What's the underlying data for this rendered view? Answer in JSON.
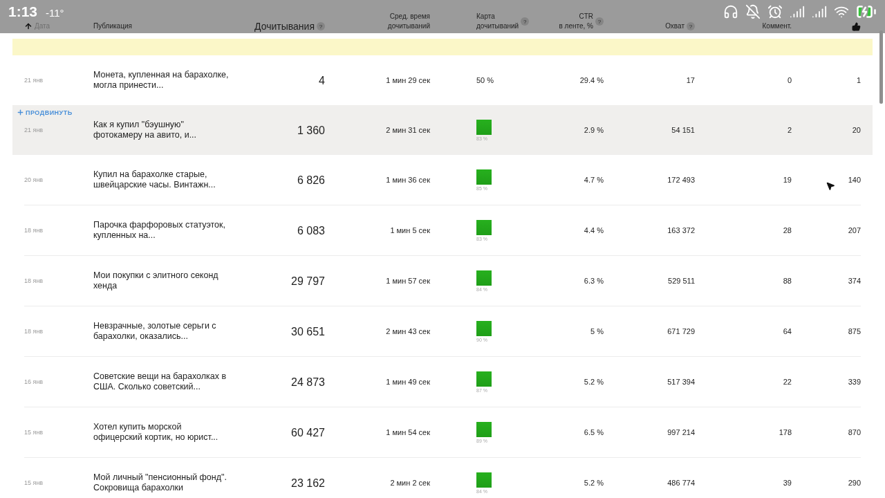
{
  "status_bar": {
    "time": "1:13",
    "temperature": "-11°"
  },
  "table": {
    "columns": [
      {
        "kind": "date",
        "lines": [
          "Дата"
        ],
        "sorted": true
      },
      {
        "kind": "publication",
        "lines": [
          "Публикация"
        ]
      },
      {
        "kind": "reads",
        "lines": [
          "Дочитывания"
        ],
        "hint": "?"
      },
      {
        "kind": "time",
        "lines": [
          "Сред. время",
          "дочитываний"
        ]
      },
      {
        "kind": "map",
        "lines": [
          "Карта",
          "дочитываний"
        ],
        "hint": "?"
      },
      {
        "kind": "ctr",
        "lines": [
          "CTR",
          "в ленте, %"
        ],
        "hint": "?"
      },
      {
        "kind": "reach",
        "lines": [
          "Охват"
        ],
        "hint": "?"
      },
      {
        "kind": "comments",
        "lines": [
          "Коммент."
        ]
      },
      {
        "kind": "likes"
      }
    ],
    "rows": [
      {
        "selected": false,
        "date": "21 янв",
        "title": "Монета, купленная на барахолке, могла принести...",
        "reads": "4",
        "time": "1 мин 29 сек",
        "map": {
          "kind": "text",
          "label": "50 %"
        },
        "ctr": "29.4 %",
        "reach": "17",
        "comments": "0",
        "likes": "1"
      },
      {
        "selected": true,
        "promote": "ПРОДВИНУТЬ",
        "date": "21 янв",
        "title": "Как я купил \"бэушную\" фотокамеру на авито, и...",
        "reads": "1 360",
        "time": "2 мин 31 сек",
        "map": {
          "kind": "square",
          "label": "83 %"
        },
        "ctr": "2.9 %",
        "reach": "54 151",
        "comments": "2",
        "likes": "20"
      },
      {
        "selected": false,
        "date": "20 янв",
        "title": "Купил на барахолке старые, швейцарские часы. Винтажн...",
        "reads": "6 826",
        "time": "1 мин 36 сек",
        "map": {
          "kind": "square",
          "label": "85 %"
        },
        "ctr": "4.7 %",
        "reach": "172 493",
        "comments": "19",
        "likes": "140"
      },
      {
        "selected": false,
        "date": "18 янв",
        "title": "Парочка фарфоровых статуэток, купленных на...",
        "reads": "6 083",
        "time": "1 мин 5 сек",
        "map": {
          "kind": "square",
          "label": "83 %"
        },
        "ctr": "4.4 %",
        "reach": "163 372",
        "comments": "28",
        "likes": "207"
      },
      {
        "selected": false,
        "date": "18 янв",
        "title": "Мои покупки с элитного секонд хенда",
        "reads": "29 797",
        "time": "1 мин 57 сек",
        "map": {
          "kind": "square",
          "label": "84 %"
        },
        "ctr": "6.3 %",
        "reach": "529 511",
        "comments": "88",
        "likes": "374"
      },
      {
        "selected": false,
        "date": "18 янв",
        "title": "Невзрачные, золотые серьги с барахолки, оказались...",
        "reads": "30 651",
        "time": "2 мин 43 сек",
        "map": {
          "kind": "square",
          "label": "90 %"
        },
        "ctr": "5 %",
        "reach": "671 729",
        "comments": "64",
        "likes": "875"
      },
      {
        "selected": false,
        "date": "16 янв",
        "title": "Советские вещи на барахолках в США. Сколько советский...",
        "reads": "24 873",
        "time": "1 мин 49 сек",
        "map": {
          "kind": "square",
          "label": "87 %"
        },
        "ctr": "5.2 %",
        "reach": "517 394",
        "comments": "22",
        "likes": "339"
      },
      {
        "selected": false,
        "date": "15 янв",
        "title": "Хотел купить морской офицерский кортик, но юрист...",
        "reads": "60 427",
        "time": "1 мин 54 сек",
        "map": {
          "kind": "square",
          "label": "89 %"
        },
        "ctr": "6.5 %",
        "reach": "997 214",
        "comments": "178",
        "likes": "870"
      },
      {
        "selected": false,
        "date": "15 янв",
        "title": "Мой личный \"пенсионный фонд\". Сокровища барахолки",
        "reads": "23 162",
        "time": "2 мин 2 сек",
        "map": {
          "kind": "square",
          "label": "84 %"
        },
        "ctr": "5.2 %",
        "reach": "486 774",
        "comments": "39",
        "likes": "290"
      }
    ]
  }
}
